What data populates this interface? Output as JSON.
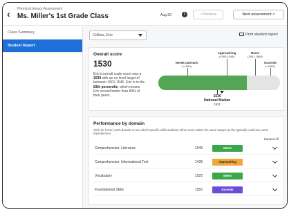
{
  "header": {
    "subtitle": "Phonics/Literacy Assessment",
    "title": "Ms. Miller's 1st Grade Class",
    "date": "Aug 20",
    "prev_label": "< Previous",
    "next_label": "Next assessment >"
  },
  "sidebar": {
    "items": [
      {
        "label": "Class Summary",
        "active": false
      },
      {
        "label": "Student Report",
        "active": true
      }
    ]
  },
  "toolbar": {
    "student_value": "Collins, Eric",
    "print_label": "Print student report"
  },
  "overall": {
    "title": "Overall score",
    "score": "1530",
    "description_pre": "Eric's overall scale score was a ",
    "description_score": "1530",
    "description_mid": " with an on level target of between 1501-1546. Eric is in the ",
    "description_pct": "83th percentile",
    "description_post": ", which means Eric scored better than 83% of their peers.",
    "bar": {
      "fill_pct": 73,
      "scale_min": 1400,
      "scale_max": 1650,
      "score_value": 1530,
      "median_value": 1521,
      "labels": {
        "needs_outreach": "Needs outreach",
        "needs_outreach_range": "(<1500)",
        "approaching": "Approaching",
        "approaching_range": "(1500-1548)",
        "meets": "Meets",
        "meets_range": "(1501-1560)",
        "exceeds": "Exceeds",
        "exceeds_range": "(>1561)",
        "score_text": "1530",
        "median_title": "National Median",
        "median_value_text": "1521"
      },
      "colors": {
        "fill": "#53a653",
        "track": "#e4e4e4"
      }
    }
  },
  "domains": {
    "title": "Performance by domain",
    "description": "Click (or hover) each domain to see which specific skills students either score within the same ranges as the typically could see some improvement.",
    "expand_label": "Expand all",
    "rows": [
      {
        "name": "Comprehension: Literature",
        "score": "1545",
        "badge": "Meets",
        "color": "#3aa84a"
      },
      {
        "name": "Comprehension: Informational Text",
        "score": "1436",
        "badge": "Approaching",
        "color": "#f0a83c"
      },
      {
        "name": "Vocabulary",
        "score": "1525",
        "badge": "Meets",
        "color": "#3aa84a"
      },
      {
        "name": "Foundational Skills",
        "score": "1550",
        "badge": "Exceeds",
        "color": "#6a4fd6"
      }
    ]
  }
}
